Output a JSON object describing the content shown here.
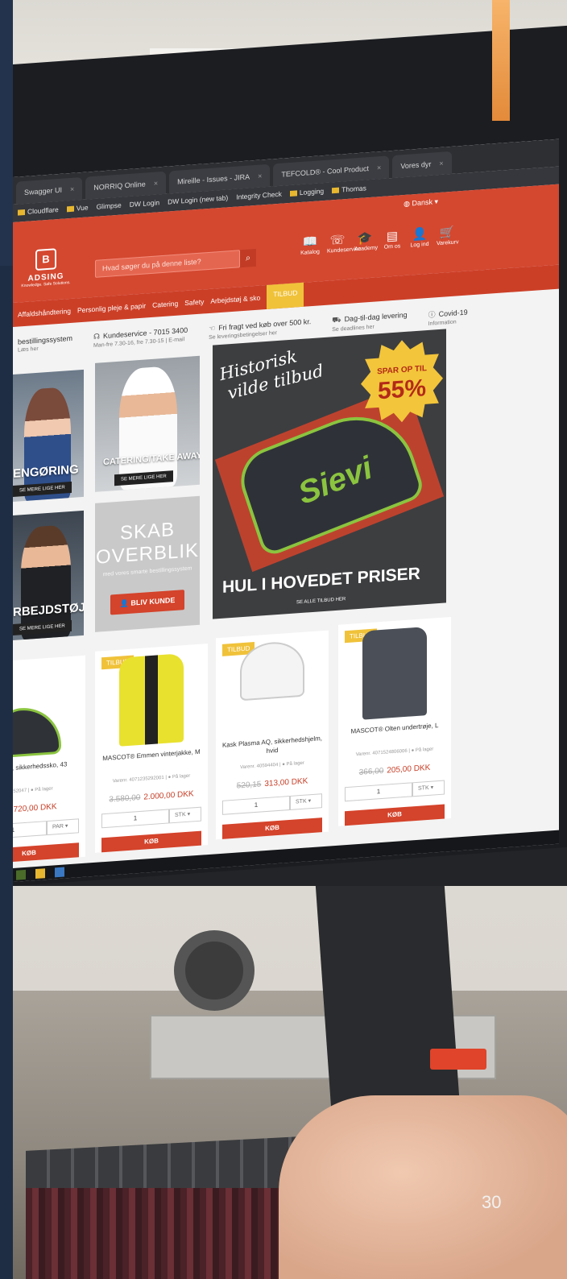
{
  "page_number": "30",
  "browser": {
    "tabs": [
      {
        "label": "Swagger UI"
      },
      {
        "label": "NORRIQ Online"
      },
      {
        "label": "Mireille - Issues - JIRA"
      },
      {
        "label": "TEFCOLD® - Cool Product"
      },
      {
        "label": "Vores dyr"
      }
    ],
    "bookmarks": [
      "Cloudflare",
      "Vue",
      "Glimpse",
      "DW Login",
      "DW Login (new tab)",
      "Integrity Check",
      "Logging",
      "Thomas"
    ]
  },
  "site": {
    "language": "Dansk",
    "logo": {
      "name": "ADSING",
      "tagline": "Knowledge. Safe Solutions."
    },
    "search_placeholder": "Hvad søger du på denne liste?",
    "nav": [
      {
        "label": "Katalog",
        "icon": "catalog-icon"
      },
      {
        "label": "Kundeservice",
        "icon": "support-icon"
      },
      {
        "label": "Academy",
        "icon": "academy-icon"
      },
      {
        "label": "Om os",
        "icon": "about-icon"
      },
      {
        "label": "Log ind",
        "icon": "user-icon"
      },
      {
        "label": "Varekurv",
        "icon": "cart-icon"
      }
    ],
    "categories": [
      "Affaldshåndtering",
      "Personlig pleje & papir",
      "Catering",
      "Safety",
      "Arbejdstøj & sko",
      "TILBUD"
    ],
    "service": [
      {
        "title": "bestillingssystem",
        "sub": "Læs her"
      },
      {
        "title": "Kundeservice - 7015 3400",
        "sub": "Man-fre 7.30-16, fre 7.30-15 | E-mail"
      },
      {
        "title": "Fri fragt ved køb over 500 kr.",
        "sub": "Se leveringsbetingelser her"
      },
      {
        "title": "Dag-til-dag levering",
        "sub": "Se deadlines her"
      },
      {
        "title": "Covid-19",
        "sub": "Information"
      }
    ]
  },
  "tiles": {
    "rengoring": {
      "label": "ENGØRING",
      "button": "SE MERE LIGE HER"
    },
    "catering": {
      "label": "CATERING/TAKE AWAY EMBALLAGE",
      "button": "SE MERE LIGE HER"
    },
    "arbejdstoj": {
      "label": "RBEJDSTØJ",
      "button": "SE MERE LIGE HER"
    },
    "skab": {
      "title_line1": "SKAB",
      "title_line2": "OVERBLIK",
      "subtitle": "med vores smarte bestillingssystem",
      "button": "BLIV KUNDE"
    }
  },
  "hero": {
    "script_line1": "Historisk",
    "script_line2": "vilde tilbud",
    "badge_top": "SPAR OP TIL",
    "badge_percent": "55%",
    "brand": "Sievi",
    "headline": "HUL I HOVEDET PRISER",
    "button": "SE ALLE TILBUD HER"
  },
  "products": [
    {
      "badge": "",
      "name": "r 2-, S3, sikkerhedssko, 43",
      "meta": "62752047 | ● På lager",
      "old_price": "00",
      "price": "720,00 DKK",
      "qty": "1",
      "unit": "PAR",
      "buy": "KØB",
      "color": "#2f3338"
    },
    {
      "badge": "TILBUD",
      "name": "MASCOT® Emmen vinterjakke, M",
      "meta": "Varenr. 4071235292001 | ● På lager",
      "old_price": "3.580,00",
      "price": "2.000,00 DKK",
      "qty": "1",
      "unit": "STK",
      "buy": "KØB",
      "color": "#e8e12e"
    },
    {
      "badge": "TILBUD",
      "name": "Kask Plasma AQ, sikkerhedshjelm, hvid",
      "meta": "Varenr. 40594404 | ● På lager",
      "old_price": "520,15",
      "price": "313,00 DKK",
      "qty": "1",
      "unit": "STK",
      "buy": "KØB",
      "color": "#f4f4f4"
    },
    {
      "badge": "TILBUD",
      "name": "MASCOT® Olten undertrøje, L",
      "meta": "Varenr. 4071524806006 | ● På lager",
      "old_price": "366,00",
      "price": "205,00 DKK",
      "qty": "1",
      "unit": "STK",
      "buy": "KØB",
      "color": "#4b5058"
    }
  ]
}
